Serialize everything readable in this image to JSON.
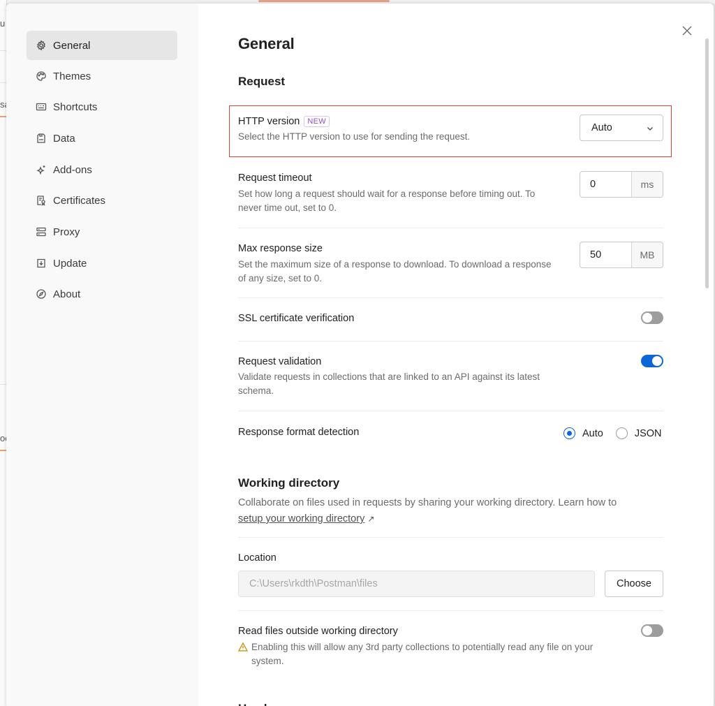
{
  "window": {
    "close_icon": "close-icon"
  },
  "background": {
    "chars": [
      "u",
      "sa",
      "oc"
    ]
  },
  "sidebar": {
    "items": [
      {
        "label": "General",
        "icon": "gear-icon",
        "active": true
      },
      {
        "label": "Themes",
        "icon": "palette-icon"
      },
      {
        "label": "Shortcuts",
        "icon": "keyboard-icon"
      },
      {
        "label": "Data",
        "icon": "database-icon"
      },
      {
        "label": "Add-ons",
        "icon": "sparkle-icon"
      },
      {
        "label": "Certificates",
        "icon": "certificate-icon"
      },
      {
        "label": "Proxy",
        "icon": "server-icon"
      },
      {
        "label": "Update",
        "icon": "download-icon"
      },
      {
        "label": "About",
        "icon": "compass-icon"
      }
    ]
  },
  "main": {
    "title": "General",
    "request": {
      "heading": "Request",
      "http_version": {
        "label": "HTTP version",
        "badge": "NEW",
        "desc": "Select the HTTP version to use for sending the request.",
        "value": "Auto"
      },
      "timeout": {
        "label": "Request timeout",
        "desc": "Set how long a request should wait for a response before timing out. To never time out, set to 0.",
        "value": "0",
        "unit": "ms"
      },
      "max_response": {
        "label": "Max response size",
        "desc": "Set the maximum size of a response to download. To download a response of any size, set to 0.",
        "value": "50",
        "unit": "MB"
      },
      "ssl": {
        "label": "SSL certificate verification",
        "enabled": false
      },
      "validation": {
        "label": "Request validation",
        "desc": "Validate requests in collections that are linked to an API against its latest schema.",
        "enabled": true
      },
      "format": {
        "label": "Response format detection",
        "options": [
          "Auto",
          "JSON"
        ],
        "selected": "Auto"
      }
    },
    "working_directory": {
      "heading": "Working directory",
      "desc": "Collaborate on files used in requests by sharing your working directory. Learn how to",
      "link": "setup your working directory",
      "link_arrow": "↗",
      "location_label": "Location",
      "location_value": "C:\\Users\\rkdth\\Postman\\files",
      "choose_label": "Choose",
      "outside": {
        "label": "Read files outside working directory",
        "warning": "Enabling this will allow any 3rd party collections to potentially read any file on your system.",
        "enabled": false
      }
    },
    "next_heading": "Headers"
  },
  "colors": {
    "accent": "#0b66d6",
    "highlight": "#e03c3c",
    "badge": "#8a4fc9"
  }
}
